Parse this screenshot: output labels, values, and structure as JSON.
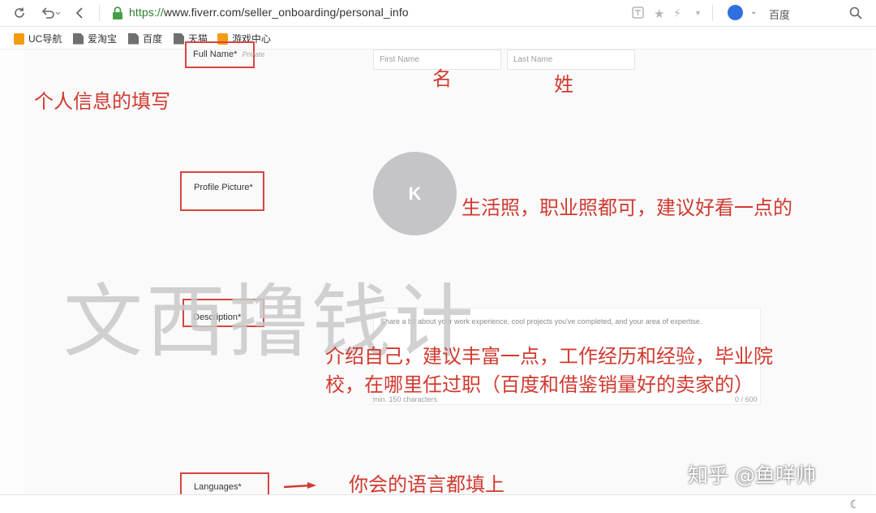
{
  "browser": {
    "url_protocol": "https://",
    "url_rest": "www.fiverr.com/seller_onboarding/personal_info",
    "search_engine": "百度",
    "bookmarks": [
      "UC导航",
      "爱淘宝",
      "百度",
      "天猫",
      "游戏中心"
    ]
  },
  "form": {
    "full_name_label": "Full Name*",
    "full_name_private": "Private",
    "first_name_placeholder": "First Name",
    "last_name_placeholder": "Last Name",
    "profile_picture_label": "Profile Picture*",
    "avatar_initial": "K",
    "description_label": "Description*",
    "description_placeholder": "Share a bit about your work experience, cool projects you've completed, and your area of expertise.",
    "description_min": "min. 150 characters",
    "description_count": "0 / 600",
    "languages_label": "Languages*"
  },
  "annotations": {
    "personal_info": "个人信息的填写",
    "first_name": "名",
    "last_name": "姓",
    "photo": "生活照，职业照都可，建议好看一点的",
    "description_line1": "介绍自己，建议丰富一点，工作经历和经验，毕业院",
    "description_line2": "校，在哪里任过职（百度和借鉴销量好的卖家的）",
    "languages": "你会的语言都填上"
  },
  "watermark": "文西撸钱计",
  "credit": "知乎 @鱼咩帅",
  "colors": {
    "annotation_red": "#d03a2f",
    "box_red": "#d64541",
    "avatar_gray": "#c5c5c7"
  }
}
